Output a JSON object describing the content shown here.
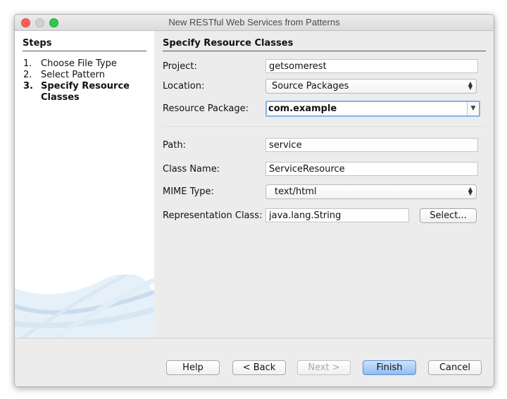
{
  "window": {
    "title": "New RESTful Web Services from Patterns"
  },
  "steps": {
    "heading": "Steps",
    "items": [
      {
        "num": "1.",
        "label": "Choose File Type"
      },
      {
        "num": "2.",
        "label": "Select Pattern"
      },
      {
        "num": "3.",
        "label": "Specify Resource Classes"
      }
    ]
  },
  "content": {
    "heading": "Specify Resource Classes",
    "project_label": "Project:",
    "project_value": "getsomerest",
    "location_label": "Location:",
    "location_value": "Source Packages",
    "package_label": "Resource Package:",
    "package_value": "com.example",
    "path_label": "Path:",
    "path_value": "service",
    "class_label": "Class Name:",
    "class_value": "ServiceResource",
    "mime_label": "MIME Type:",
    "mime_value": "text/html",
    "repr_label": "Representation Class:",
    "repr_value": "java.lang.String",
    "select_label": "Select..."
  },
  "buttons": {
    "help": "Help",
    "back": "< Back",
    "next": "Next >",
    "finish": "Finish",
    "cancel": "Cancel"
  }
}
